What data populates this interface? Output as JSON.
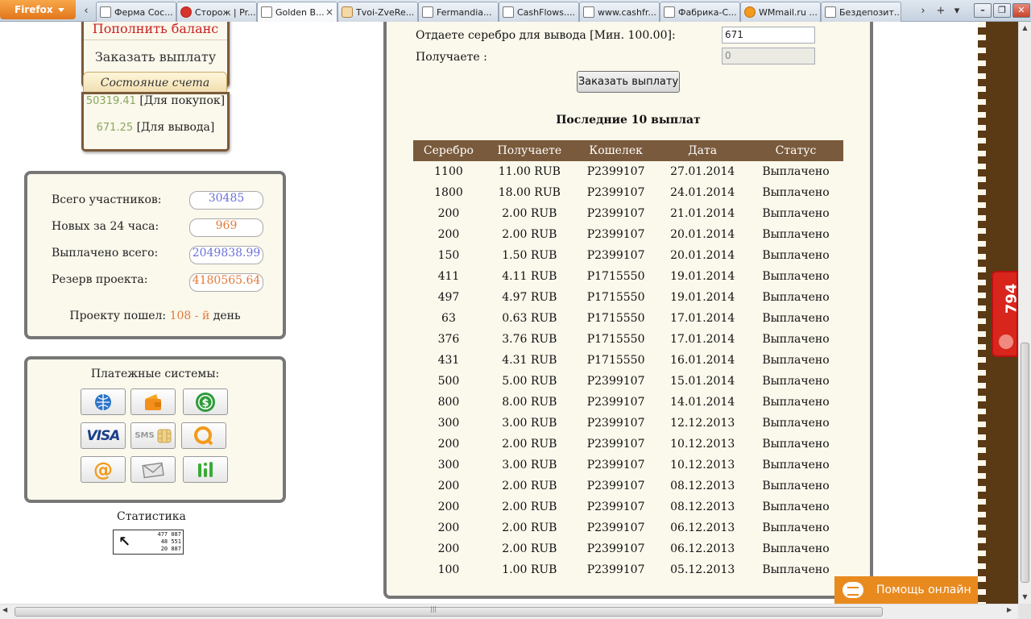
{
  "browser": {
    "menu_label": "Firefox",
    "tabs": [
      {
        "label": "Ферма Сос...",
        "active": false
      },
      {
        "label": "Сторож | Pr...",
        "active": false
      },
      {
        "label": "Golden B...",
        "active": true
      },
      {
        "label": "Tvoi-ZveRe...",
        "active": false
      },
      {
        "label": "Fermandia...",
        "active": false
      },
      {
        "label": "CashFlows....",
        "active": false
      },
      {
        "label": "www.cashfr...",
        "active": false
      },
      {
        "label": "Фабрика-С...",
        "active": false
      },
      {
        "label": "WMmail.ru ...",
        "active": false
      },
      {
        "label": "Бездепозит...",
        "active": false
      }
    ],
    "close_tab": "×",
    "scroll_left": "‹",
    "scroll_right": "›",
    "new_tab": "+",
    "list_tabs": "▾",
    "window_min": "–",
    "window_max": "❐",
    "window_close": "✕"
  },
  "sidebar": {
    "topup_label": "Пополнить баланс",
    "order_payout_label": "Заказать выплату",
    "account_state_title": "Состояние счета",
    "purchase_balance": "50319.41",
    "purchase_label": "[Для покупок]",
    "withdraw_balance": "671.25",
    "withdraw_label": "[Для вывода]"
  },
  "stats": {
    "total_label": "Всего участников:",
    "total_value": "30485",
    "new_label": "Новых за 24 часа:",
    "new_value": "969",
    "paid_label": "Выплачено всего:",
    "paid_value": "2049838.99",
    "reserve_label": "Резерв проекта:",
    "reserve_value": "4180565.64",
    "days_prefix": "Проекту пошел:",
    "days_value": "108 - й",
    "days_suffix": "день"
  },
  "payment_systems": {
    "title": "Платежные системы:",
    "icons": [
      "webmoney-icon",
      "wallet-icon",
      "dollar-icon",
      "visa-icon",
      "sms-icon",
      "qiwi-icon",
      "mailru-icon",
      "envelope-icon",
      "bars-icon"
    ],
    "visa_text": "VISA",
    "sms_text": "SMS"
  },
  "statistics": {
    "title": "Статистика",
    "counter_lines": [
      "477 087",
      "48 551",
      "20 887"
    ]
  },
  "withdraw_form": {
    "give_label": "Отдаете серебро для вывода [Мин. 100.00]:",
    "give_value": "671",
    "receive_label": "Получаете :",
    "receive_value": "0",
    "submit_label": "Заказать выплату"
  },
  "last_payouts": {
    "title": "Последние 10 выплат",
    "headers": [
      "Серебро",
      "Получаете",
      "Кошелек",
      "Дата",
      "Статус"
    ],
    "rows": [
      [
        "1100",
        "11.00 RUB",
        "P2399107",
        "27.01.2014",
        "Выплачено"
      ],
      [
        "1800",
        "18.00 RUB",
        "P2399107",
        "24.01.2014",
        "Выплачено"
      ],
      [
        "200",
        "2.00 RUB",
        "P2399107",
        "21.01.2014",
        "Выплачено"
      ],
      [
        "200",
        "2.00 RUB",
        "P2399107",
        "20.01.2014",
        "Выплачено"
      ],
      [
        "150",
        "1.50 RUB",
        "P2399107",
        "20.01.2014",
        "Выплачено"
      ],
      [
        "411",
        "4.11 RUB",
        "P1715550",
        "19.01.2014",
        "Выплачено"
      ],
      [
        "497",
        "4.97 RUB",
        "P1715550",
        "19.01.2014",
        "Выплачено"
      ],
      [
        "63",
        "0.63 RUB",
        "P1715550",
        "17.01.2014",
        "Выплачено"
      ],
      [
        "376",
        "3.76 RUB",
        "P1715550",
        "17.01.2014",
        "Выплачено"
      ],
      [
        "431",
        "4.31 RUB",
        "P1715550",
        "16.01.2014",
        "Выплачено"
      ],
      [
        "500",
        "5.00 RUB",
        "P2399107",
        "15.01.2014",
        "Выплачено"
      ],
      [
        "800",
        "8.00 RUB",
        "P2399107",
        "14.01.2014",
        "Выплачено"
      ],
      [
        "300",
        "3.00 RUB",
        "P2399107",
        "12.12.2013",
        "Выплачено"
      ],
      [
        "200",
        "2.00 RUB",
        "P2399107",
        "10.12.2013",
        "Выплачено"
      ],
      [
        "300",
        "3.00 RUB",
        "P2399107",
        "10.12.2013",
        "Выплачено"
      ],
      [
        "200",
        "2.00 RUB",
        "P2399107",
        "08.12.2013",
        "Выплачено"
      ],
      [
        "200",
        "2.00 RUB",
        "P2399107",
        "08.12.2013",
        "Выплачено"
      ],
      [
        "200",
        "2.00 RUB",
        "P2399107",
        "06.12.2013",
        "Выплачено"
      ],
      [
        "200",
        "2.00 RUB",
        "P2399107",
        "06.12.2013",
        "Выплачено"
      ],
      [
        "100",
        "1.00 RUB",
        "P2399107",
        "05.12.2013",
        "Выплачено"
      ]
    ]
  },
  "widgets": {
    "badge_number": "794",
    "help_label": "Помощь онлайн"
  },
  "scrollbars": {
    "grip": "|||",
    "up": "▲",
    "down": "▼",
    "left": "◀",
    "right": "▶"
  },
  "colors": {
    "accent_brown": "#7a5a3c",
    "highlight_orange": "#e07a3a",
    "value_blue": "#6b70d9",
    "help_orange": "#e98a1f",
    "badge_red": "#d8261d"
  }
}
